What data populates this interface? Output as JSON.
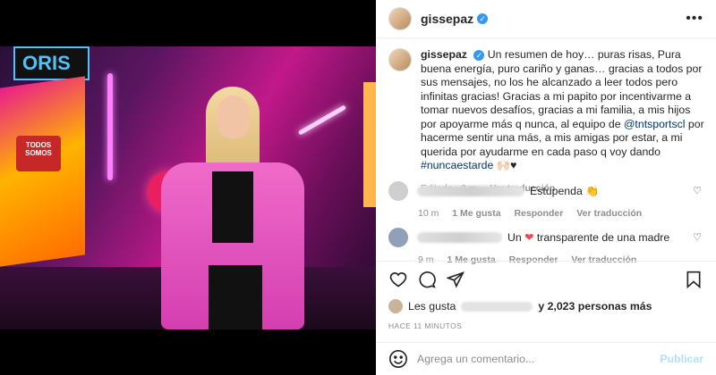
{
  "photo": {
    "studio_logo_text": "ORIS",
    "badge_text": "TODOS SOMOS"
  },
  "post": {
    "username": "gissepaz",
    "verified": true,
    "more_icon": "more-horizontal-icon"
  },
  "caption": {
    "username": "gissepaz",
    "text_part1": "Un resumen de hoy… puras risas, Pura buena energía, puro cariño y ganas… gracias a todos por sus mensajes, no los he alcanzado a leer todos pero infinitas gracias! Gracias a mi papito por incentivarme a tomar nuevos desafíos, gracias a mi familia, a mis hijos por apoyarme más q nunca, al equipo de ",
    "mention": "@tntsportscl",
    "text_part2": " por hacerme sentir una más, a mis amigas por estar, a mi querida por ayudarme en cada paso q voy dando ",
    "hashtag": "#nuncaestarde",
    "emoji_tail": " 🙌🏻♥",
    "edited": "Editado · 2 m",
    "translation": "Ver traducción"
  },
  "comments": [
    {
      "text": "Estupenda 👏",
      "time": "10 m",
      "likes": "1 Me gusta",
      "reply": "Responder",
      "translation": "Ver traducción"
    },
    {
      "text_before": "Un ",
      "text_after": " transparente de una madre",
      "time": "9 m",
      "likes": "1 Me gusta",
      "reply": "Responder",
      "translation": "Ver traducción"
    }
  ],
  "likes": {
    "prefix": "Les gusta",
    "suffix": "y 2,023 personas más"
  },
  "timestamp": "HACE 11 MINUTOS",
  "add_comment": {
    "placeholder": "Agrega un comentario...",
    "publish": "Publicar"
  },
  "colors": {
    "verified": "#3897f0",
    "mention": "#00376b",
    "heart": "#ed4956",
    "publish_disabled": "#b2dffc"
  }
}
